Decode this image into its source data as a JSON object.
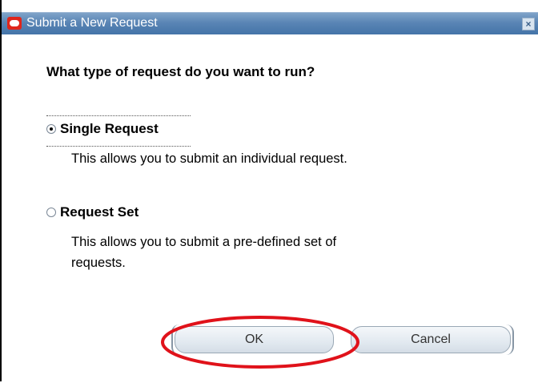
{
  "window": {
    "title": "Submit a New Request",
    "close_glyph": "×"
  },
  "dialog": {
    "question": "What type of request do you want to run?",
    "options": [
      {
        "label": "Single Request",
        "description": "This allows you to submit an individual request.",
        "selected": true
      },
      {
        "label": "Request Set",
        "description": "This allows you to submit a pre-defined set of requests.",
        "selected": false
      }
    ]
  },
  "buttons": {
    "ok_label": "OK",
    "cancel_label": "Cancel"
  },
  "annotation": {
    "highlight_color": "#e0121a"
  },
  "icons": {
    "app_logo": "oracle-logo-icon",
    "close": "close-icon",
    "radio_selected": "radio-selected-icon",
    "radio_unselected": "radio-unselected-icon"
  }
}
